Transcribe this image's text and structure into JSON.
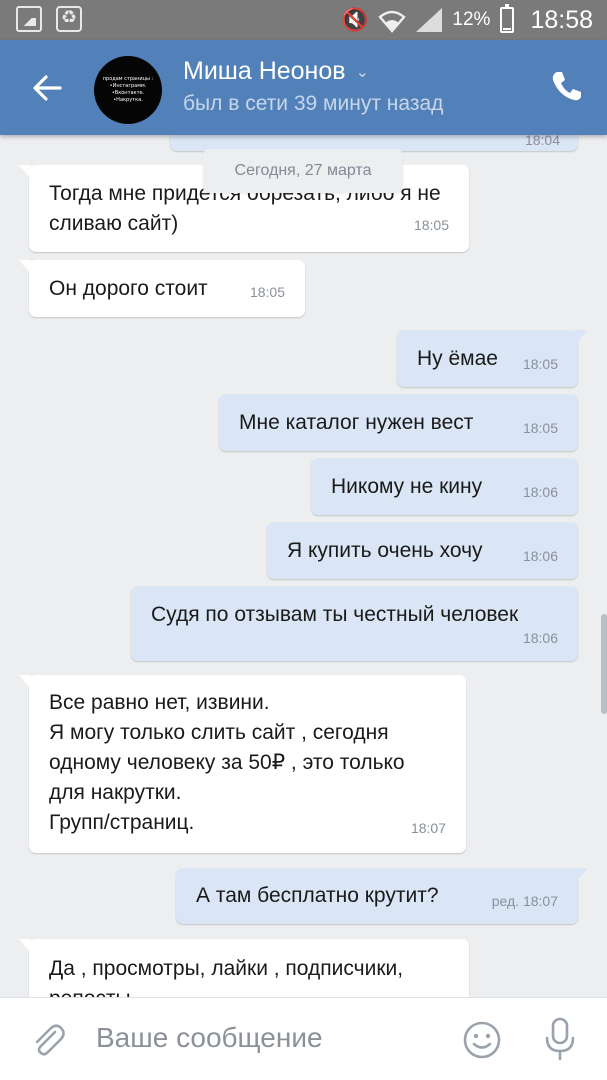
{
  "status_bar": {
    "battery": "12%",
    "time": "18:58"
  },
  "header": {
    "name": "Миша Неонов",
    "status": "был в сети 39 минут назад",
    "avatar_text": [
      "продам страницы :",
      "•Инстаграмм.",
      "•Вконтакте.",
      "•Накрутка."
    ]
  },
  "chat": {
    "date_separator": "Сегодня, 27 марта",
    "prev_time_fragment": "18:04",
    "messages": [
      {
        "dir": "in",
        "text": "Тогда мне придется обрезать, либо я не сливаю сайт)",
        "time": "18:05"
      },
      {
        "dir": "in",
        "text": "Он дорого стоит",
        "time": "18:05"
      },
      {
        "dir": "out",
        "text": "Ну ёмае",
        "time": "18:05"
      },
      {
        "dir": "out",
        "text": "Мне каталог нужен вест",
        "time": "18:05"
      },
      {
        "dir": "out",
        "text": "Никому не кину",
        "time": "18:06"
      },
      {
        "dir": "out",
        "text": "Я купить очень хочу",
        "time": "18:06"
      },
      {
        "dir": "out",
        "text": "Судя по отзывам ты честный человек",
        "time": "18:06"
      },
      {
        "dir": "in",
        "text": "Все равно нет, извини.\nЯ могу только слить сайт , сегодня одному человеку за 50₽ , это только для накрутки.\nГрупп/страниц.",
        "time": "18:07"
      },
      {
        "dir": "out",
        "text": "А там бесплатно крутит?",
        "time": "ред. 18:07"
      },
      {
        "dir": "in",
        "text": "Да , просмотры, лайки , подписчики, репосты",
        "time": ""
      }
    ]
  },
  "composer": {
    "placeholder": "Ваше сообщение"
  },
  "colors": {
    "header": "#5181b8",
    "out_bubble": "#dae6f5",
    "in_bubble": "#ffffff",
    "background": "#edeef0"
  },
  "icons": [
    "gallery-icon",
    "recycle-icon",
    "mute-icon",
    "wifi-icon",
    "signal-icon",
    "battery-icon",
    "back-arrow-icon",
    "chevron-down-icon",
    "phone-icon",
    "paperclip-icon",
    "emoji-icon",
    "microphone-icon"
  ]
}
